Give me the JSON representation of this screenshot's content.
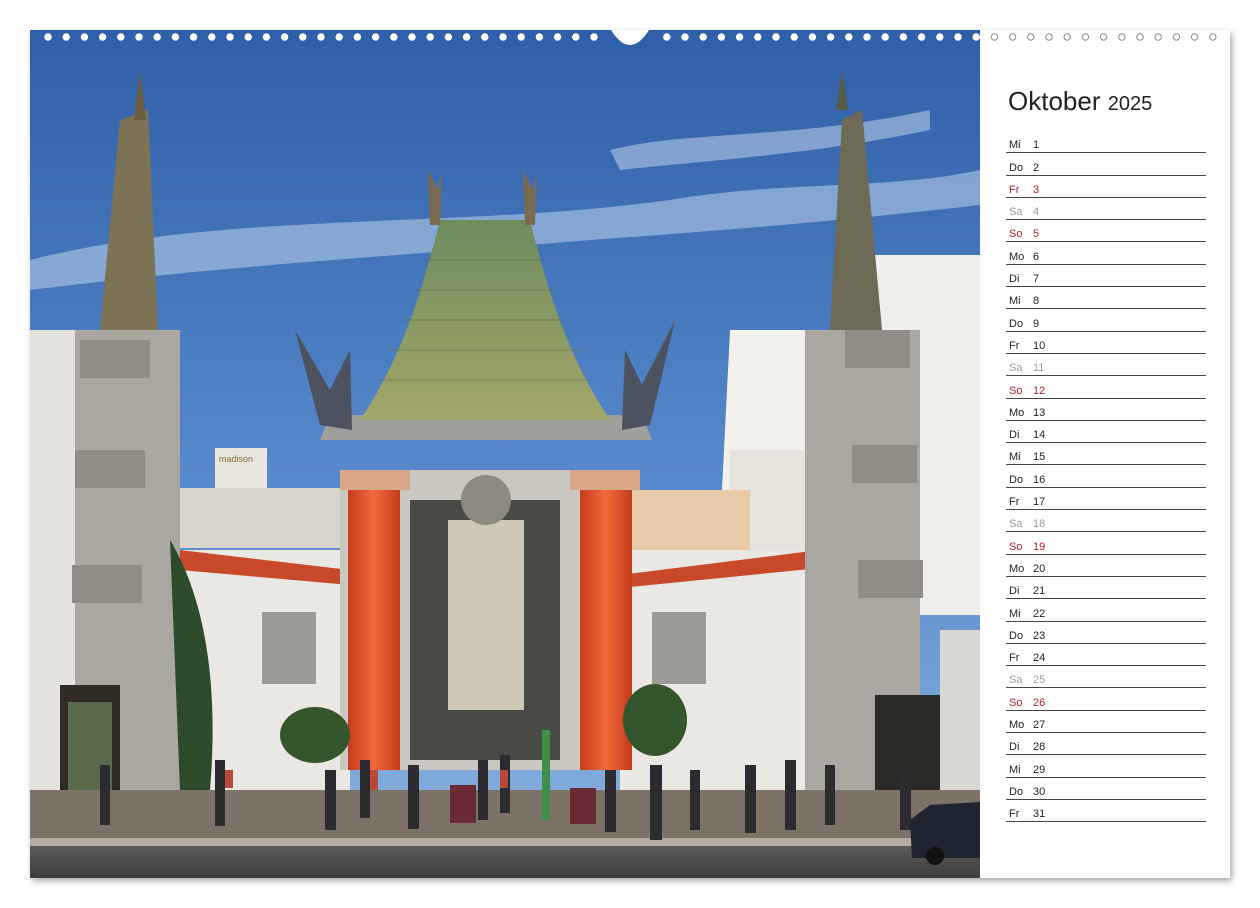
{
  "calendar": {
    "month": "Oktober",
    "year": "2025",
    "days": [
      {
        "wd": "Mi",
        "d": "1",
        "type": "normal"
      },
      {
        "wd": "Do",
        "d": "2",
        "type": "normal"
      },
      {
        "wd": "Fr",
        "d": "3",
        "type": "sun"
      },
      {
        "wd": "Sa",
        "d": "4",
        "type": "sat"
      },
      {
        "wd": "So",
        "d": "5",
        "type": "sun"
      },
      {
        "wd": "Mo",
        "d": "6",
        "type": "normal"
      },
      {
        "wd": "Di",
        "d": "7",
        "type": "normal"
      },
      {
        "wd": "Mi",
        "d": "8",
        "type": "normal"
      },
      {
        "wd": "Do",
        "d": "9",
        "type": "normal"
      },
      {
        "wd": "Fr",
        "d": "10",
        "type": "normal"
      },
      {
        "wd": "Sa",
        "d": "11",
        "type": "sat"
      },
      {
        "wd": "So",
        "d": "12",
        "type": "sun"
      },
      {
        "wd": "Mo",
        "d": "13",
        "type": "normal"
      },
      {
        "wd": "Di",
        "d": "14",
        "type": "normal"
      },
      {
        "wd": "Mi",
        "d": "15",
        "type": "normal"
      },
      {
        "wd": "Do",
        "d": "16",
        "type": "normal"
      },
      {
        "wd": "Fr",
        "d": "17",
        "type": "normal"
      },
      {
        "wd": "Sa",
        "d": "18",
        "type": "sat"
      },
      {
        "wd": "So",
        "d": "19",
        "type": "sun"
      },
      {
        "wd": "Mo",
        "d": "20",
        "type": "normal"
      },
      {
        "wd": "Di",
        "d": "21",
        "type": "normal"
      },
      {
        "wd": "Mi",
        "d": "22",
        "type": "normal"
      },
      {
        "wd": "Do",
        "d": "23",
        "type": "normal"
      },
      {
        "wd": "Fr",
        "d": "24",
        "type": "normal"
      },
      {
        "wd": "Sa",
        "d": "25",
        "type": "sat"
      },
      {
        "wd": "So",
        "d": "26",
        "type": "sun"
      },
      {
        "wd": "Mo",
        "d": "27",
        "type": "normal"
      },
      {
        "wd": "Di",
        "d": "28",
        "type": "normal"
      },
      {
        "wd": "Mi",
        "d": "29",
        "type": "normal"
      },
      {
        "wd": "Do",
        "d": "30",
        "type": "normal"
      },
      {
        "wd": "Fr",
        "d": "31",
        "type": "normal"
      }
    ]
  },
  "photo": {
    "sign_text": "madison"
  },
  "colors": {
    "sunday_holiday": "#b3202a",
    "saturday": "#9a9a9a",
    "sky": "#3f6fb8",
    "roof": "#7e9a6a",
    "column": "#e2532c"
  }
}
